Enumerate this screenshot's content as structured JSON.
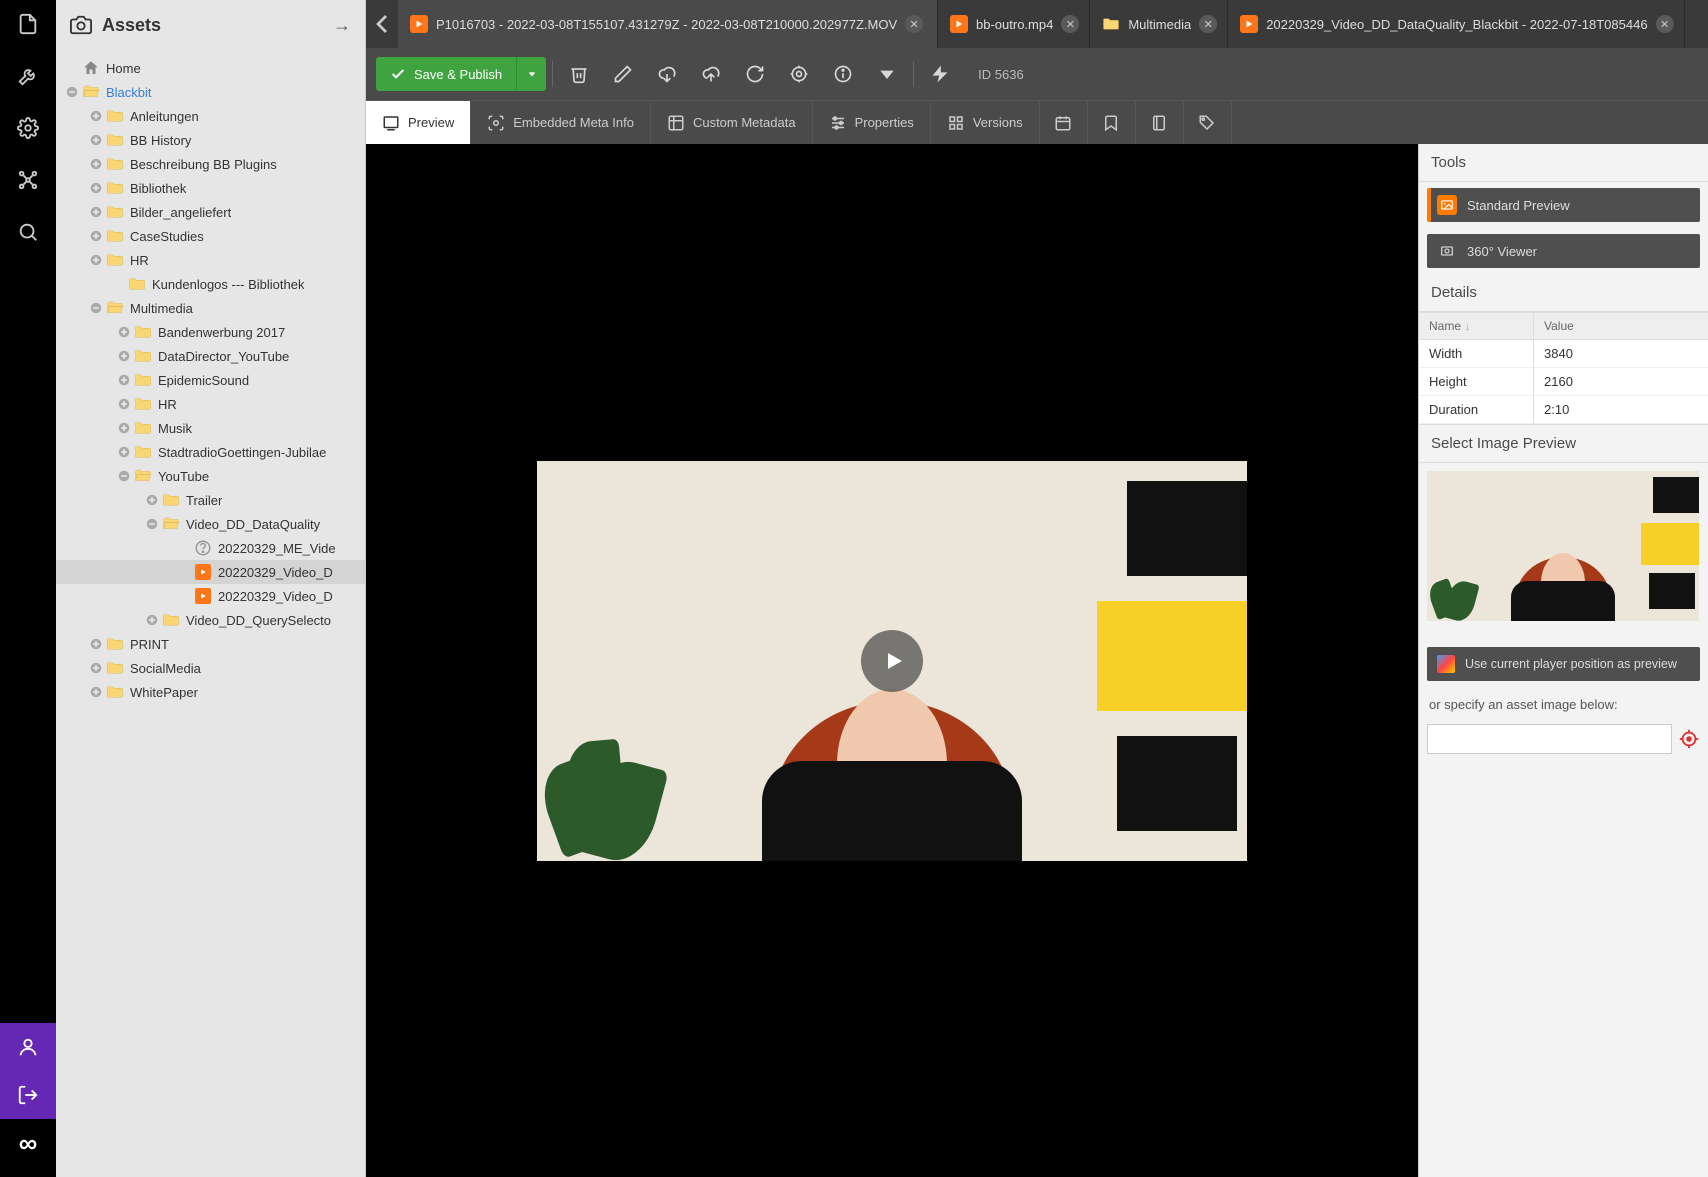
{
  "panel": {
    "title": "Assets"
  },
  "tabs": [
    {
      "label": "P1016703 - 2022-03-08T155107.431279Z - 2022-03-08T210000.202977Z.MOV",
      "icon": "orange",
      "active": true
    },
    {
      "label": "bb-outro.mp4",
      "icon": "orange",
      "active": false
    },
    {
      "label": "Multimedia",
      "icon": "folder",
      "active": false
    },
    {
      "label": "20220329_Video_DD_DataQuality_Blackbit - 2022-07-18T085446",
      "icon": "orange",
      "active": false
    }
  ],
  "toolbar": {
    "save_label": "Save & Publish",
    "id_label": "ID 5636"
  },
  "subtabs": {
    "preview": "Preview",
    "embedded": "Embedded Meta Info",
    "custom": "Custom Metadata",
    "properties": "Properties",
    "versions": "Versions"
  },
  "right": {
    "tools_title": "Tools",
    "standard_preview": "Standard Preview",
    "viewer_360": "360° Viewer",
    "details_title": "Details",
    "th_name": "Name",
    "th_value": "Value",
    "rows": [
      {
        "name": "Width",
        "value": "3840"
      },
      {
        "name": "Height",
        "value": "2160"
      },
      {
        "name": "Duration",
        "value": "2:10"
      }
    ],
    "select_preview_title": "Select Image Preview",
    "use_position": "Use current player position as preview",
    "specify": "or specify an asset image below:"
  },
  "tree": {
    "home": "Home",
    "blackbit": "Blackbit",
    "items": [
      "Anleitungen",
      "BB History",
      "Beschreibung BB Plugins",
      "Bibliothek",
      "Bilder_angeliefert",
      "CaseStudies",
      "HR"
    ],
    "kundenlogos": "Kundenlogos --- Bibliothek",
    "multimedia": "Multimedia",
    "mm_children": [
      "Bandenwerbung 2017",
      "DataDirector_YouTube",
      "EpidemicSound",
      "HR",
      "Musik",
      "StadtradioGoettingen-Jubilae"
    ],
    "youtube": "YouTube",
    "yt_trailer": "Trailer",
    "yt_video_dd": "Video_DD_DataQuality",
    "yt_files": [
      "20220329_ME_Vide",
      "20220329_Video_D",
      "20220329_Video_D"
    ],
    "yt_query": "Video_DD_QuerySelecto",
    "print": "PRINT",
    "social": "SocialMedia",
    "white": "WhitePaper"
  }
}
